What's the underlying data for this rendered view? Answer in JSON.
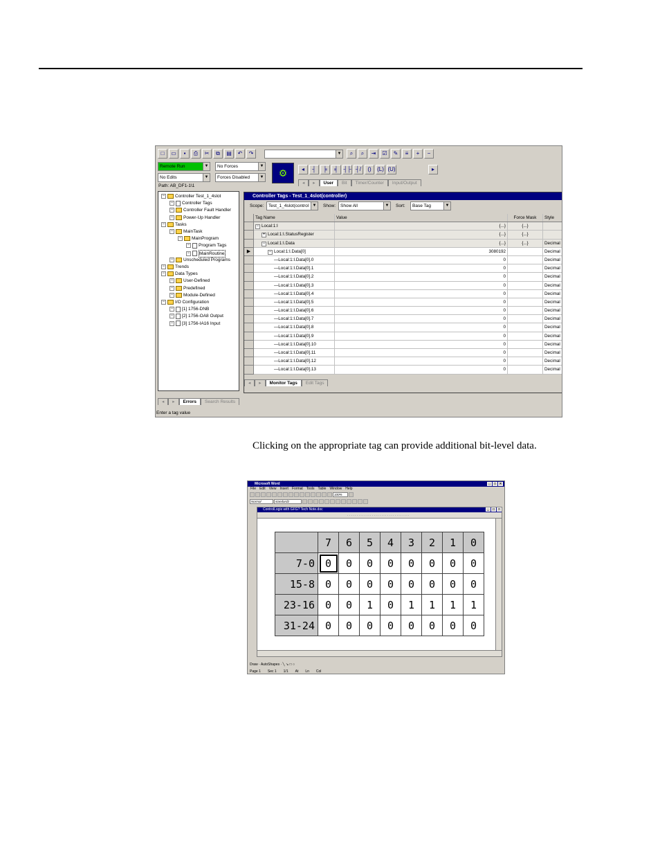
{
  "caption": "Clicking on the appropriate tag can provide additional bit-level data.",
  "rslogix": {
    "mode": "Remote Run",
    "forces": "No Forces",
    "edits": "No Edits",
    "forces_state": "Forces Disabled",
    "path": "Path: AB_DF1-1\\1",
    "toolbar_tabs": [
      "User",
      "Bit",
      "Timer/Counter",
      "Input/Output"
    ],
    "organizer": [
      {
        "label": "Controller Test_1_4slot",
        "level": 0,
        "icon": "folder"
      },
      {
        "label": "Controller Tags",
        "level": 1,
        "icon": "doc"
      },
      {
        "label": "Controller Fault Handler",
        "level": 1,
        "icon": "folder"
      },
      {
        "label": "Power-Up Handler",
        "level": 1,
        "icon": "folder"
      },
      {
        "label": "Tasks",
        "level": 0,
        "icon": "folder"
      },
      {
        "label": "MainTask",
        "level": 1,
        "icon": "folder"
      },
      {
        "label": "MainProgram",
        "level": 2,
        "icon": "folder"
      },
      {
        "label": "Program Tags",
        "level": 3,
        "icon": "doc"
      },
      {
        "label": "MainRoutine",
        "level": 3,
        "icon": "doc"
      },
      {
        "label": "Unscheduled Programs",
        "level": 1,
        "icon": "folder"
      },
      {
        "label": "Trends",
        "level": 0,
        "icon": "folder"
      },
      {
        "label": "Data Types",
        "level": 0,
        "icon": "folder"
      },
      {
        "label": "User-Defined",
        "level": 1,
        "icon": "folder"
      },
      {
        "label": "Predefined",
        "level": 1,
        "icon": "folder"
      },
      {
        "label": "Module-Defined",
        "level": 1,
        "icon": "folder"
      },
      {
        "label": "I/O Configuration",
        "level": 0,
        "icon": "folder"
      },
      {
        "label": "[1] 1756-DNB",
        "level": 1,
        "icon": "doc"
      },
      {
        "label": "[2] 1756-OA8 Output",
        "level": 1,
        "icon": "doc"
      },
      {
        "label": "[3] 1756-IA16 Input",
        "level": 1,
        "icon": "doc"
      }
    ],
    "tag_window": {
      "title": "Controller Tags - Test_1_4slot(controller)",
      "scope_label": "Scope:",
      "scope_value": "Test_1_4slot(control",
      "show_label": "Show:",
      "show_value": "Show All",
      "sort_label": "Sort:",
      "sort_value": "Base Tag",
      "columns": [
        "Tag Name",
        "Value",
        "Force Mask",
        "Style"
      ],
      "rows": [
        {
          "name": "Local:1:I",
          "indent": 0,
          "value": "{...}",
          "force": "{...}",
          "style": "",
          "pm": "−"
        },
        {
          "name": "Local:1:I.StatusRegister",
          "indent": 1,
          "value": "{...}",
          "force": "{...}",
          "style": "",
          "pm": "+"
        },
        {
          "name": "Local:1:I.Data",
          "indent": 1,
          "value": "{...}",
          "force": "{...}",
          "style": "Decimal",
          "pm": "−"
        },
        {
          "name": "Local:1:I.Data[0]",
          "indent": 2,
          "value": "3080192",
          "force": "",
          "style": "Decimal",
          "pm": "−"
        },
        {
          "name": "Local:1:I.Data[0].0",
          "indent": 3,
          "value": "0",
          "force": "",
          "style": "Decimal",
          "pm": ""
        },
        {
          "name": "Local:1:I.Data[0].1",
          "indent": 3,
          "value": "0",
          "force": "",
          "style": "Decimal",
          "pm": ""
        },
        {
          "name": "Local:1:I.Data[0].2",
          "indent": 3,
          "value": "0",
          "force": "",
          "style": "Decimal",
          "pm": ""
        },
        {
          "name": "Local:1:I.Data[0].3",
          "indent": 3,
          "value": "0",
          "force": "",
          "style": "Decimal",
          "pm": ""
        },
        {
          "name": "Local:1:I.Data[0].4",
          "indent": 3,
          "value": "0",
          "force": "",
          "style": "Decimal",
          "pm": ""
        },
        {
          "name": "Local:1:I.Data[0].5",
          "indent": 3,
          "value": "0",
          "force": "",
          "style": "Decimal",
          "pm": ""
        },
        {
          "name": "Local:1:I.Data[0].6",
          "indent": 3,
          "value": "0",
          "force": "",
          "style": "Decimal",
          "pm": ""
        },
        {
          "name": "Local:1:I.Data[0].7",
          "indent": 3,
          "value": "0",
          "force": "",
          "style": "Decimal",
          "pm": ""
        },
        {
          "name": "Local:1:I.Data[0].8",
          "indent": 3,
          "value": "0",
          "force": "",
          "style": "Decimal",
          "pm": ""
        },
        {
          "name": "Local:1:I.Data[0].9",
          "indent": 3,
          "value": "0",
          "force": "",
          "style": "Decimal",
          "pm": ""
        },
        {
          "name": "Local:1:I.Data[0].10",
          "indent": 3,
          "value": "0",
          "force": "",
          "style": "Decimal",
          "pm": ""
        },
        {
          "name": "Local:1:I.Data[0].11",
          "indent": 3,
          "value": "0",
          "force": "",
          "style": "Decimal",
          "pm": ""
        },
        {
          "name": "Local:1:I.Data[0].12",
          "indent": 3,
          "value": "0",
          "force": "",
          "style": "Decimal",
          "pm": ""
        },
        {
          "name": "Local:1:I.Data[0].13",
          "indent": 3,
          "value": "0",
          "force": "",
          "style": "Decimal",
          "pm": ""
        }
      ],
      "bottom_tabs": [
        "Monitor Tags",
        "Edit Tags"
      ]
    },
    "bottom_tabs": [
      "Errors",
      "Search Results"
    ],
    "status": "Enter a tag value"
  },
  "word": {
    "title": "Microsoft Word",
    "doc_title": "ControlLogix with GFG? Tech Note.doc",
    "menu": [
      "File",
      "Edit",
      "View",
      "Insert",
      "Format",
      "Tools",
      "Table",
      "Window",
      "Help"
    ],
    "style_box": "Normal",
    "font_box": "standard2",
    "zoom": "100%",
    "draw_label": "Draw",
    "autoshapes_label": "AutoShapes",
    "status": [
      "Page 1",
      "Sec 1",
      "1/1",
      "At",
      "Ln",
      "Col"
    ],
    "bit_headers": [
      "7",
      "6",
      "5",
      "4",
      "3",
      "2",
      "1",
      "0"
    ],
    "bit_rows": [
      {
        "label": "7-0",
        "bits": [
          "0",
          "0",
          "0",
          "0",
          "0",
          "0",
          "0",
          "0"
        ]
      },
      {
        "label": "15-8",
        "bits": [
          "0",
          "0",
          "0",
          "0",
          "0",
          "0",
          "0",
          "0"
        ]
      },
      {
        "label": "23-16",
        "bits": [
          "0",
          "0",
          "1",
          "0",
          "1",
          "1",
          "1",
          "1"
        ]
      },
      {
        "label": "31-24",
        "bits": [
          "0",
          "0",
          "0",
          "0",
          "0",
          "0",
          "0",
          "0"
        ]
      }
    ]
  }
}
